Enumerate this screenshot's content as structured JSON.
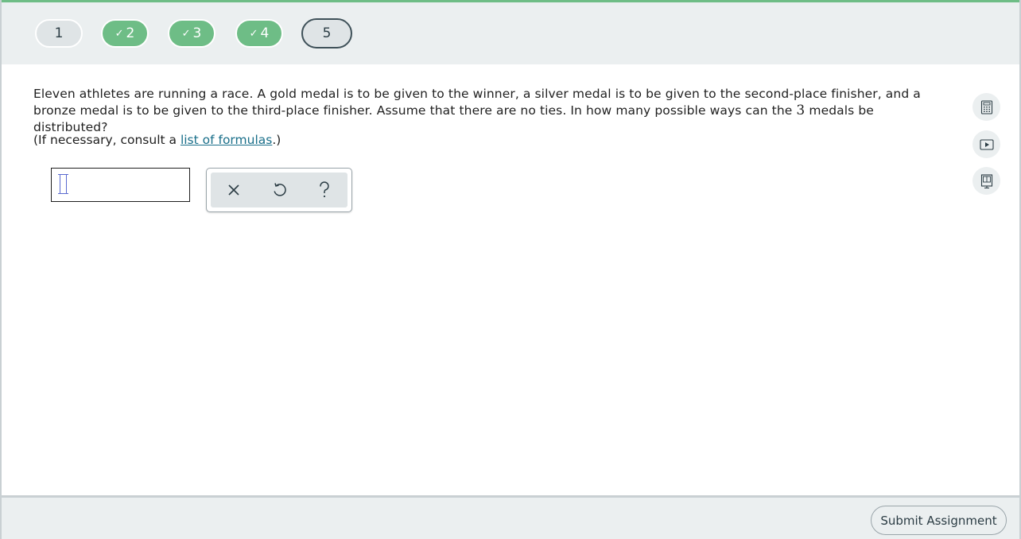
{
  "nav": {
    "steps": [
      {
        "label": "1",
        "status": "plain"
      },
      {
        "label": "2",
        "status": "done"
      },
      {
        "label": "3",
        "status": "done"
      },
      {
        "label": "4",
        "status": "done"
      },
      {
        "label": "5",
        "status": "current"
      }
    ],
    "check_glyph": "✓"
  },
  "question": {
    "text_before": "Eleven athletes are running a race. A gold medal is to be given to the winner, a silver medal is to be given to the second-place finisher, and a bronze medal is to be given to the third-place finisher. Assume that there are no ties. In how many possible ways can the ",
    "number": "3",
    "text_after": " medals be distributed?"
  },
  "formulas": {
    "prefix": "(If necessary, consult a ",
    "link_label": "list of formulas",
    "suffix": ".)"
  },
  "answer": {
    "value": ""
  },
  "tools": {
    "clear_icon": "×",
    "undo_icon": "undo-icon",
    "help_icon": "?"
  },
  "side_tools": [
    "calculator-icon",
    "video-icon",
    "textbook-icon"
  ],
  "footer": {
    "submit_label": "Submit Assignment"
  },
  "colors": {
    "accent_green": "#6ebd86",
    "link": "#1a6f8a",
    "bar_bg": "#ebeff0",
    "text_dark": "#2b3c44"
  }
}
